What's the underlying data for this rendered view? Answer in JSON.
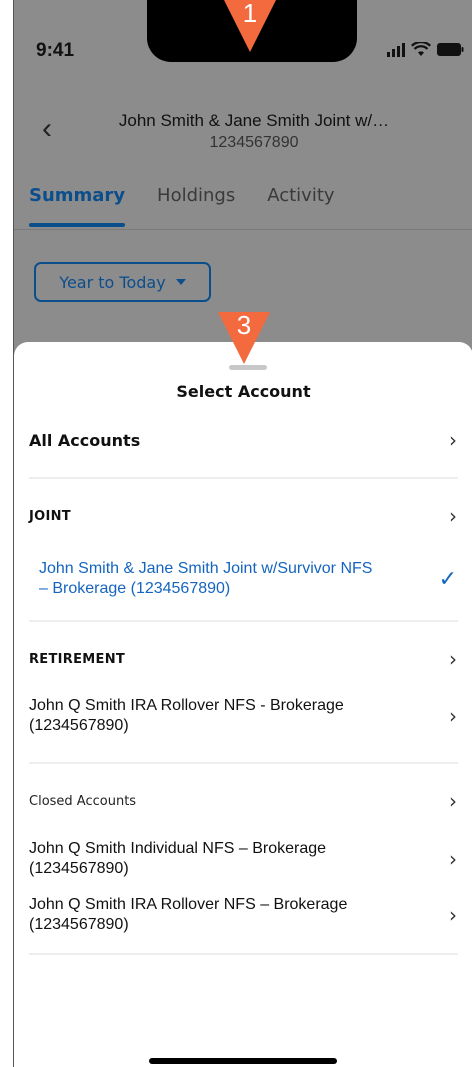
{
  "status": {
    "time": "9:41"
  },
  "header": {
    "title": "John Smith & Jane Smith Joint w/…",
    "account_number": "1234567890"
  },
  "tabs": [
    {
      "label": "Summary",
      "active": true
    },
    {
      "label": "Holdings"
    },
    {
      "label": "Activity"
    }
  ],
  "period": {
    "label": "Year to Today"
  },
  "sheet": {
    "title": "Select Account",
    "all_accounts": "All Accounts",
    "joint": {
      "section": "JOINT",
      "account_line1": "John Smith & Jane Smith Joint w/Survivor NFS",
      "account_line2": "– Brokerage (1234567890)"
    },
    "retirement": {
      "section": "RETIREMENT",
      "account_line1": "John Q Smith IRA Rollover NFS - Brokerage",
      "account_line2": "(1234567890)"
    },
    "closed": {
      "section": "Closed Accounts",
      "accounts": [
        {
          "line1": "John Q Smith Individual NFS – Brokerage",
          "line2": "(1234567890)"
        },
        {
          "line1": "John Q Smith IRA Rollover NFS – Brokerage",
          "line2": "(1234567890)"
        }
      ]
    }
  },
  "markers": {
    "top": "1",
    "sheet": "3"
  },
  "colors": {
    "accent": "#0b4e8c",
    "selected": "#1565c0",
    "marker": "#f26a3d",
    "overlay": "#8c8c8c"
  }
}
